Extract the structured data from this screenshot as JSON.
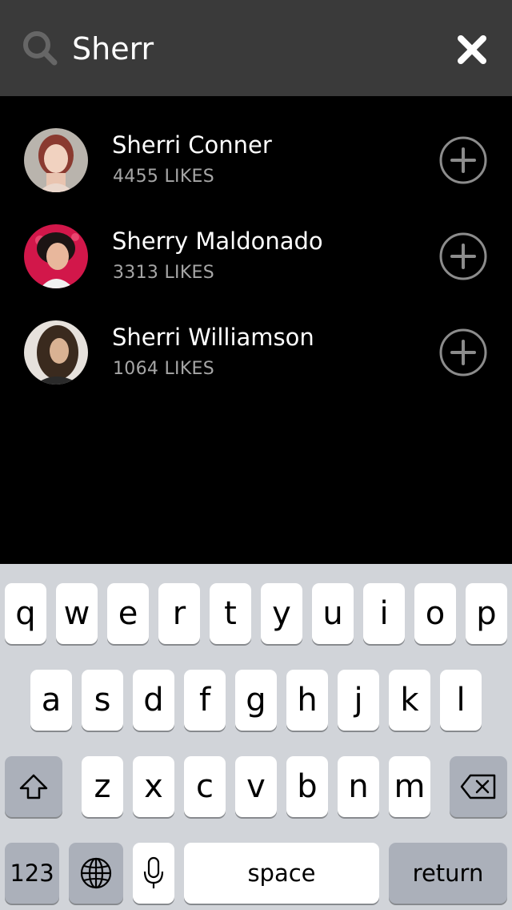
{
  "search": {
    "query": "Sherr",
    "icon": "search-icon",
    "close_icon": "close-icon"
  },
  "results": [
    {
      "name": "Sherri Conner",
      "likes": "4455 LIKES",
      "action_icon": "plus-circle-icon"
    },
    {
      "name": "Sherry Maldonado",
      "likes": "3313 LIKES",
      "action_icon": "plus-circle-icon"
    },
    {
      "name": "Sherri Williamson",
      "likes": "1064 LIKES",
      "action_icon": "plus-circle-icon"
    }
  ],
  "keyboard": {
    "row1": [
      "q",
      "w",
      "e",
      "r",
      "t",
      "y",
      "u",
      "i",
      "o",
      "p"
    ],
    "row2": [
      "a",
      "s",
      "d",
      "f",
      "g",
      "h",
      "j",
      "k",
      "l"
    ],
    "row3": [
      "z",
      "x",
      "c",
      "v",
      "b",
      "n",
      "m"
    ],
    "numbers_label": "123",
    "space_label": "space",
    "return_label": "return",
    "shift_icon": "shift-icon",
    "delete_icon": "backspace-icon",
    "globe_icon": "globe-icon",
    "mic_icon": "microphone-icon"
  },
  "colors": {
    "header_bg": "#3a3a3a",
    "list_bg": "#000000",
    "keyboard_bg": "#d1d4d9",
    "likes_text": "#a6a6a6"
  }
}
